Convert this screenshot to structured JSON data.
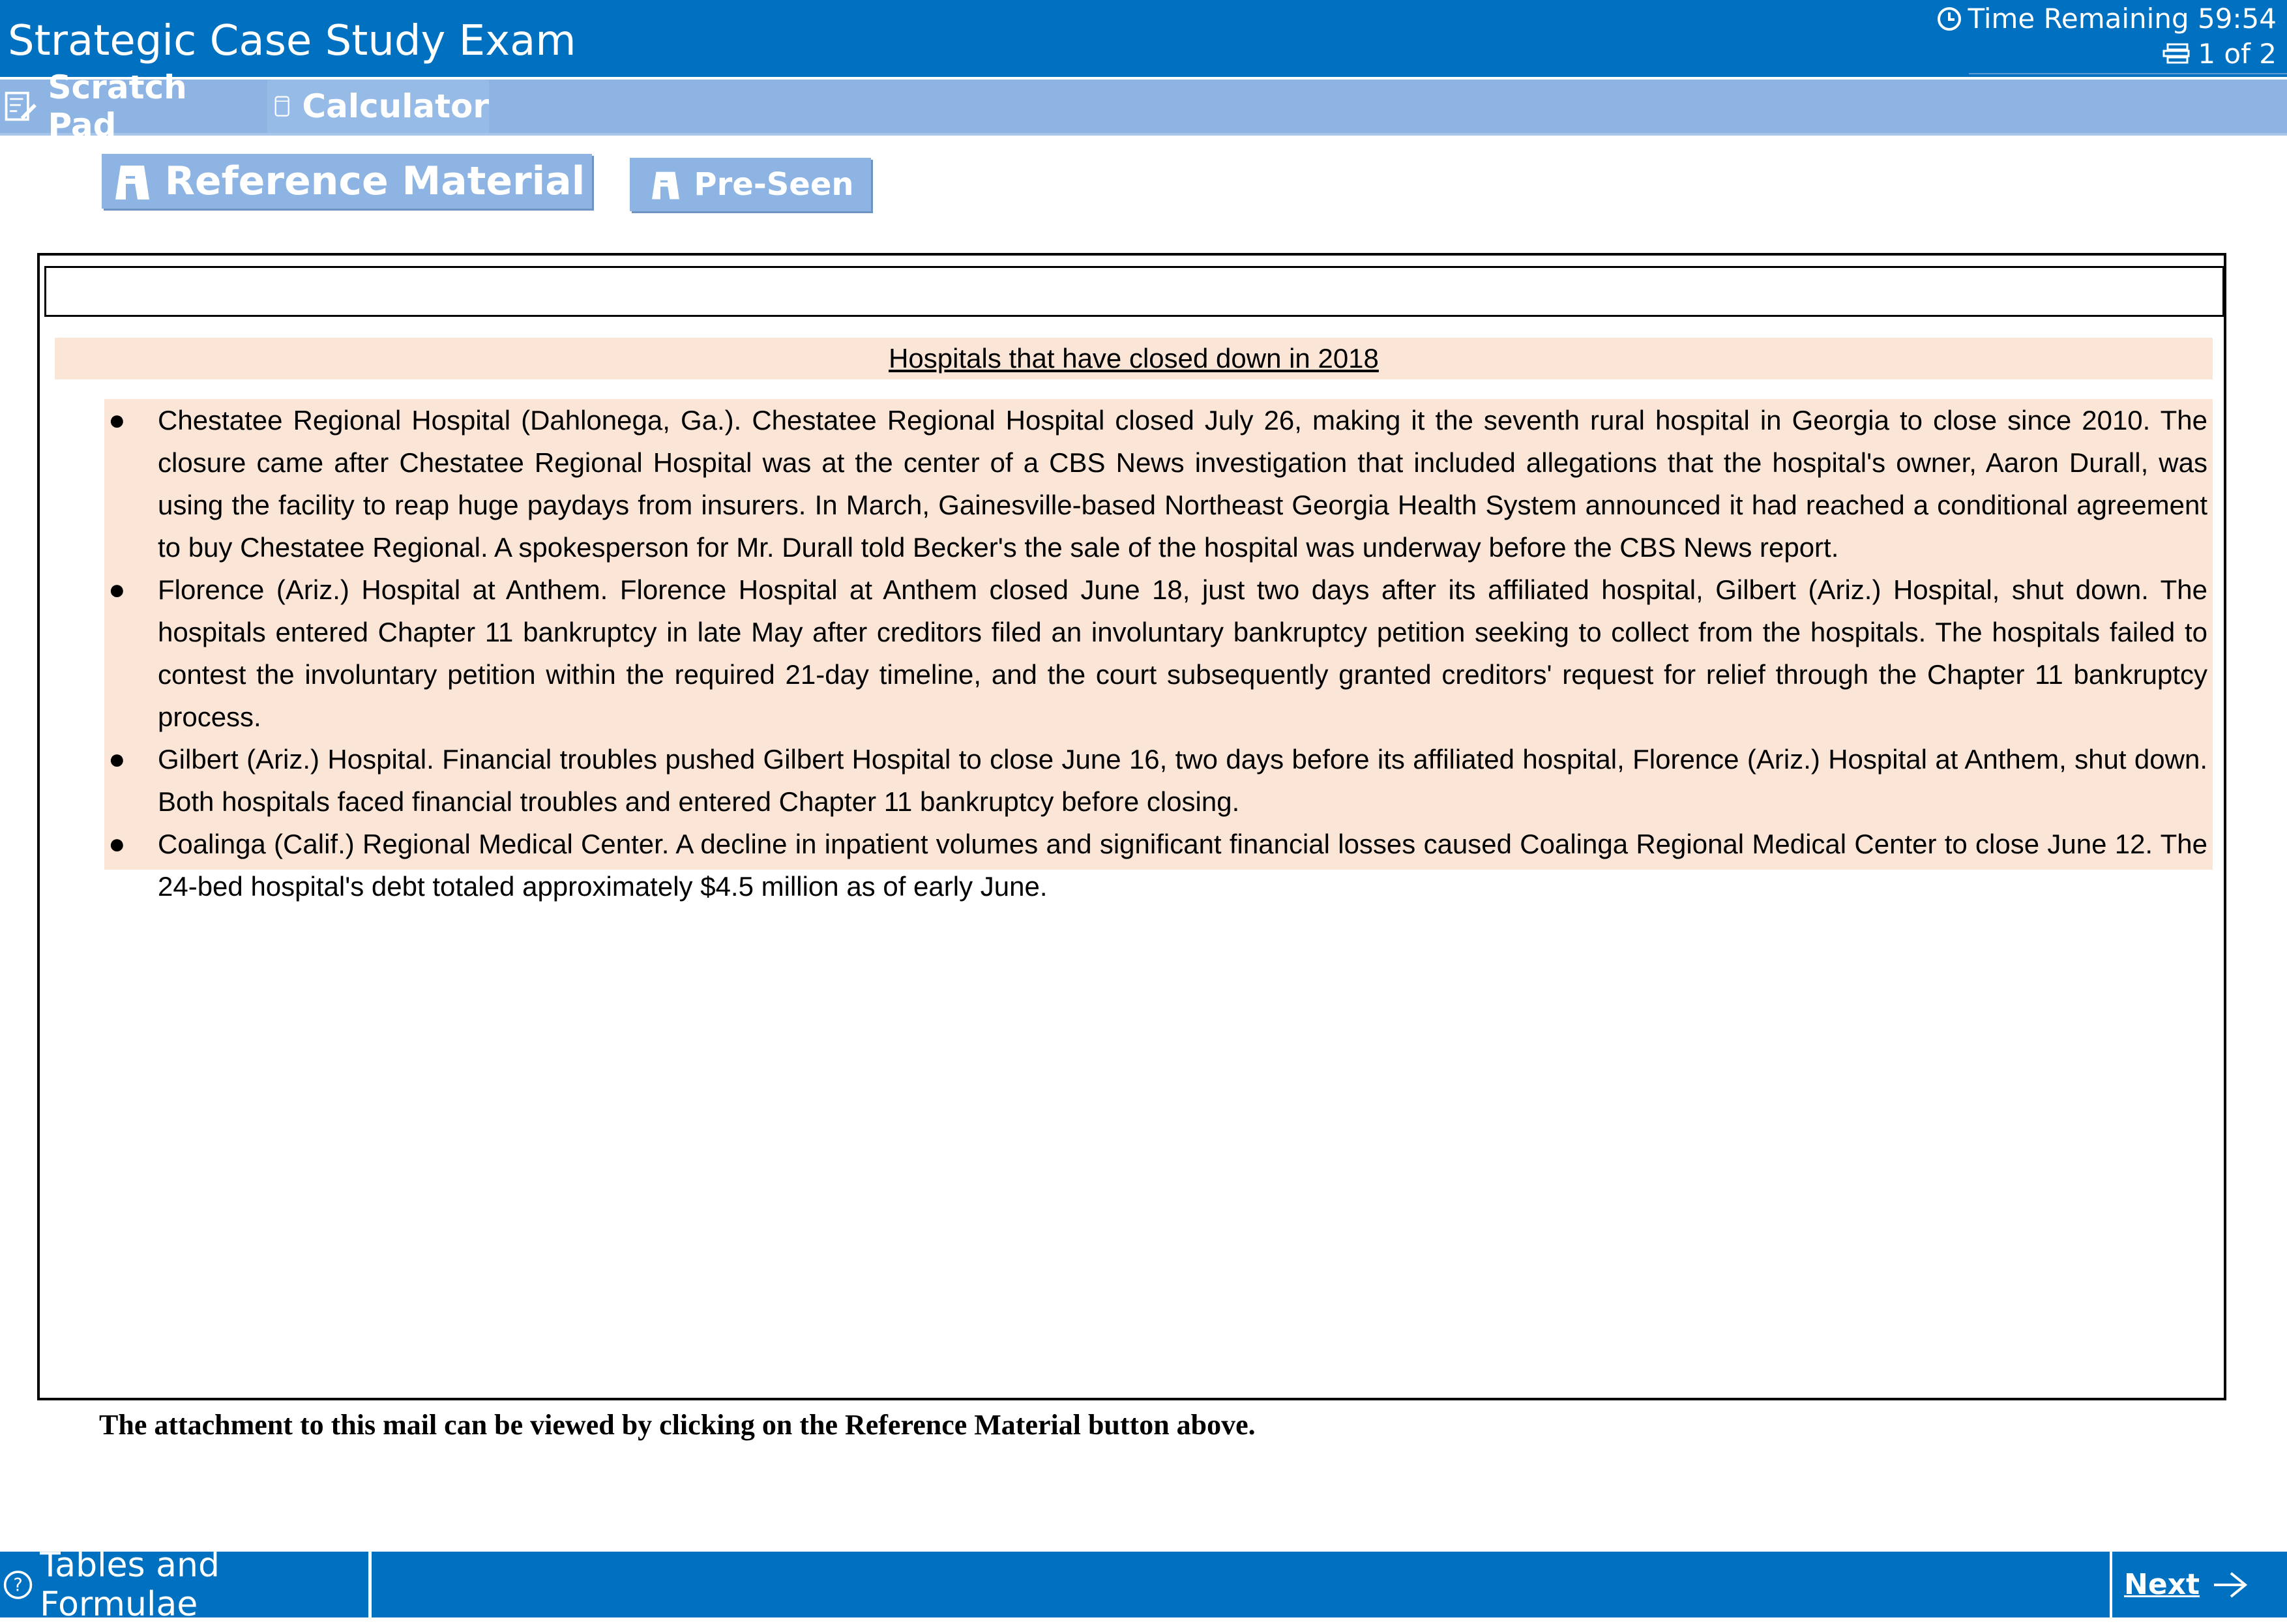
{
  "header": {
    "title": "Strategic Case Study Exam",
    "timer_label": "Time Remaining 59:54",
    "page_indicator": "1 of 2",
    "clock_icon": "clock-icon",
    "pages_icon": "pages-icon"
  },
  "toolbar": {
    "scratch_pad_label": "Scratch Pad",
    "calculator_label": "Calculator"
  },
  "reference_buttons": {
    "reference_label": "Reference Material",
    "preseen_label": "Pre-Seen"
  },
  "document": {
    "heading": "Hospitals that have closed down in 2018",
    "items": [
      "Chestatee Regional Hospital (Dahlonega, Ga.). Chestatee Regional Hospital closed July 26, making it the seventh rural hospital in Georgia to close since 2010. The closure came after Chestatee Regional Hospital was at the center of a CBS News investigation that included allegations that the hospital's owner, Aaron Durall, was using the facility to reap huge paydays from insurers. In March, Gainesville-based Northeast Georgia Health System announced it had reached a conditional agreement to buy Chestatee Regional. A spokesperson for Mr. Durall told Becker's the sale of the hospital was underway before the CBS News report.",
      "Florence (Ariz.) Hospital at Anthem. Florence Hospital at Anthem closed June 18, just two days after its affiliated hospital, Gilbert (Ariz.) Hospital, shut down. The hospitals entered Chapter 11 bankruptcy in late May after creditors filed an involuntary bankruptcy petition seeking to collect from the hospitals. The hospitals failed to contest the involuntary petition within the required 21-day timeline, and the court subsequently granted creditors' request for relief through the Chapter 11 bankruptcy process.",
      "Gilbert (Ariz.) Hospital. Financial troubles pushed Gilbert Hospital to close June 16, two days before its affiliated hospital, Florence (Ariz.) Hospital at Anthem, shut down. Both hospitals faced financial troubles and entered Chapter 11 bankruptcy before closing.",
      "Coalinga (Calif.) Regional Medical Center. A decline in inpatient volumes and significant financial losses caused Coalinga Regional Medical Center to close June 12. The 24-bed hospital's debt totaled approximately $4.5 million as of early June."
    ]
  },
  "footer_note": "The attachment to this mail can be viewed by clicking on the Reference Material button above.",
  "bottom_bar": {
    "tables_label": "Tables and Formulae",
    "next_label": "Next"
  },
  "colors": {
    "header_blue": "#0070c0",
    "toolbar_blue": "#8db4e2",
    "highlight_peach": "#fbe5d6"
  }
}
